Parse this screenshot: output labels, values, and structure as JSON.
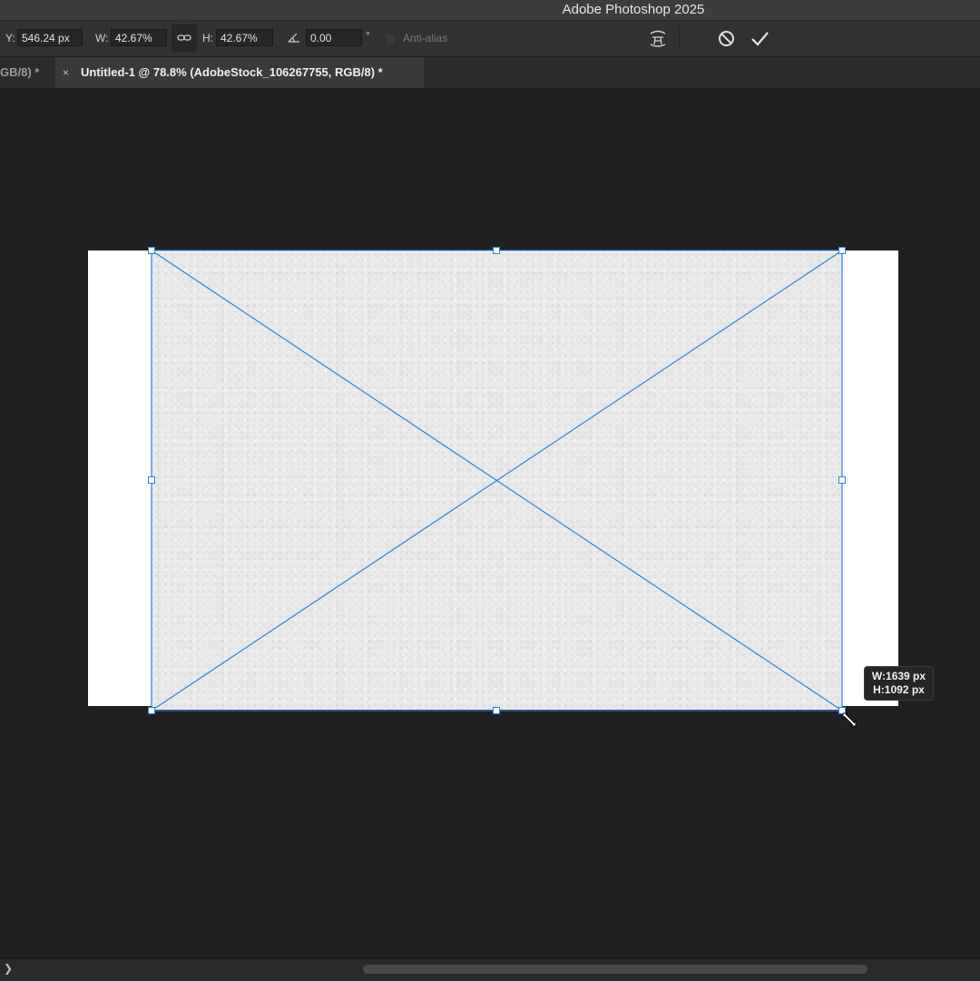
{
  "window": {
    "title": "Adobe Photoshop 2025"
  },
  "options_bar": {
    "y_label": "Y:",
    "y_value": "546.24 px",
    "w_label": "W:",
    "w_value": "42.67%",
    "link_icon": "link-icon",
    "h_label": "H:",
    "h_value": "42.67%",
    "angle_icon": "angle-icon",
    "angle_value": "0.00",
    "degree_symbol": "°",
    "anti_alias_label": "Anti-alias",
    "anti_alias_checked": false,
    "warp_icon": "warp-icon",
    "cancel_icon": "cancel-icon",
    "commit_icon": "commit-check-icon"
  },
  "tabs": {
    "inactive_label": "GB/8) *",
    "active_close": "×",
    "active_label": "Untitled-1 @ 78.8% (AdobeStock_106267755, RGB/8) *"
  },
  "transform": {
    "w_readout": "W:1639 px",
    "h_readout": "H:1092 px"
  },
  "scroll": {
    "arrow": "❯"
  },
  "colors": {
    "background": "#202020",
    "transform_line": "#2f7fe0",
    "canvas": "#ffffff"
  }
}
